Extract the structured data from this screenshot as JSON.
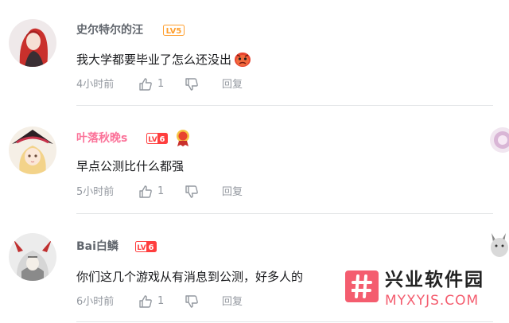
{
  "comments": [
    {
      "username": "史尔特尔的汪",
      "level": "LV5",
      "content": "我大学都要毕业了怎么还没出",
      "time": "4小时前",
      "likes": "1",
      "reply_label": "回复",
      "username_color": "#61666d",
      "level_color": "#ff9f2e"
    },
    {
      "username": "叶落秋晚s",
      "level": "LV6",
      "content": "早点公测比什么都强",
      "time": "5小时前",
      "likes": "1",
      "reply_label": "回复",
      "username_color": "#fb7299",
      "level_color": "#ff3e3e"
    },
    {
      "username": "Bai白鳞",
      "level": "LV6",
      "content": "你们这几个游戏从有消息到公测，好多人的",
      "time": "6小时前",
      "likes": "1",
      "reply_label": "回复",
      "username_color": "#61666d",
      "level_color": "#ff3e3e"
    }
  ],
  "watermark": {
    "title": "兴业软件园",
    "subtitle": "MYXYJS.COM",
    "brand_color": "#f45d6f"
  },
  "icons": {
    "like": "thumbs-up-icon",
    "dislike": "thumbs-down-icon",
    "emoji": "angry-face-emoji-icon",
    "medal": "fan-medal-icon"
  }
}
